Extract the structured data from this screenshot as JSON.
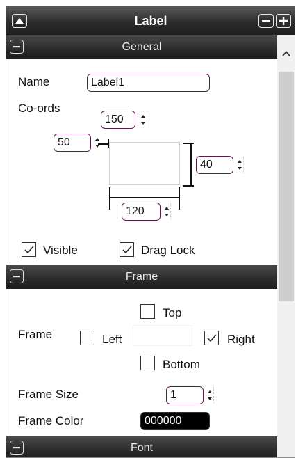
{
  "titlebar": {
    "title": "Label"
  },
  "sections": {
    "general": {
      "title": "General"
    },
    "frame": {
      "title": "Frame"
    },
    "font": {
      "title": "Font"
    }
  },
  "general": {
    "name_label": "Name",
    "name_value": "Label1",
    "coords_label": "Co-ords",
    "y_value": "150",
    "x_value": "50",
    "height_value": "40",
    "width_value": "120",
    "visible_label": "Visible",
    "visible_checked": true,
    "draglock_label": "Drag Lock",
    "draglock_checked": true
  },
  "frame": {
    "frame_label": "Frame",
    "top_label": "Top",
    "top_checked": false,
    "left_label": "Left",
    "left_checked": false,
    "right_label": "Right",
    "right_checked": true,
    "bottom_label": "Bottom",
    "bottom_checked": false,
    "frame_size_label": "Frame Size",
    "frame_size_value": "1",
    "frame_color_label": "Frame Color",
    "frame_color_value": "000000",
    "frame_color_hex": "#000000"
  }
}
